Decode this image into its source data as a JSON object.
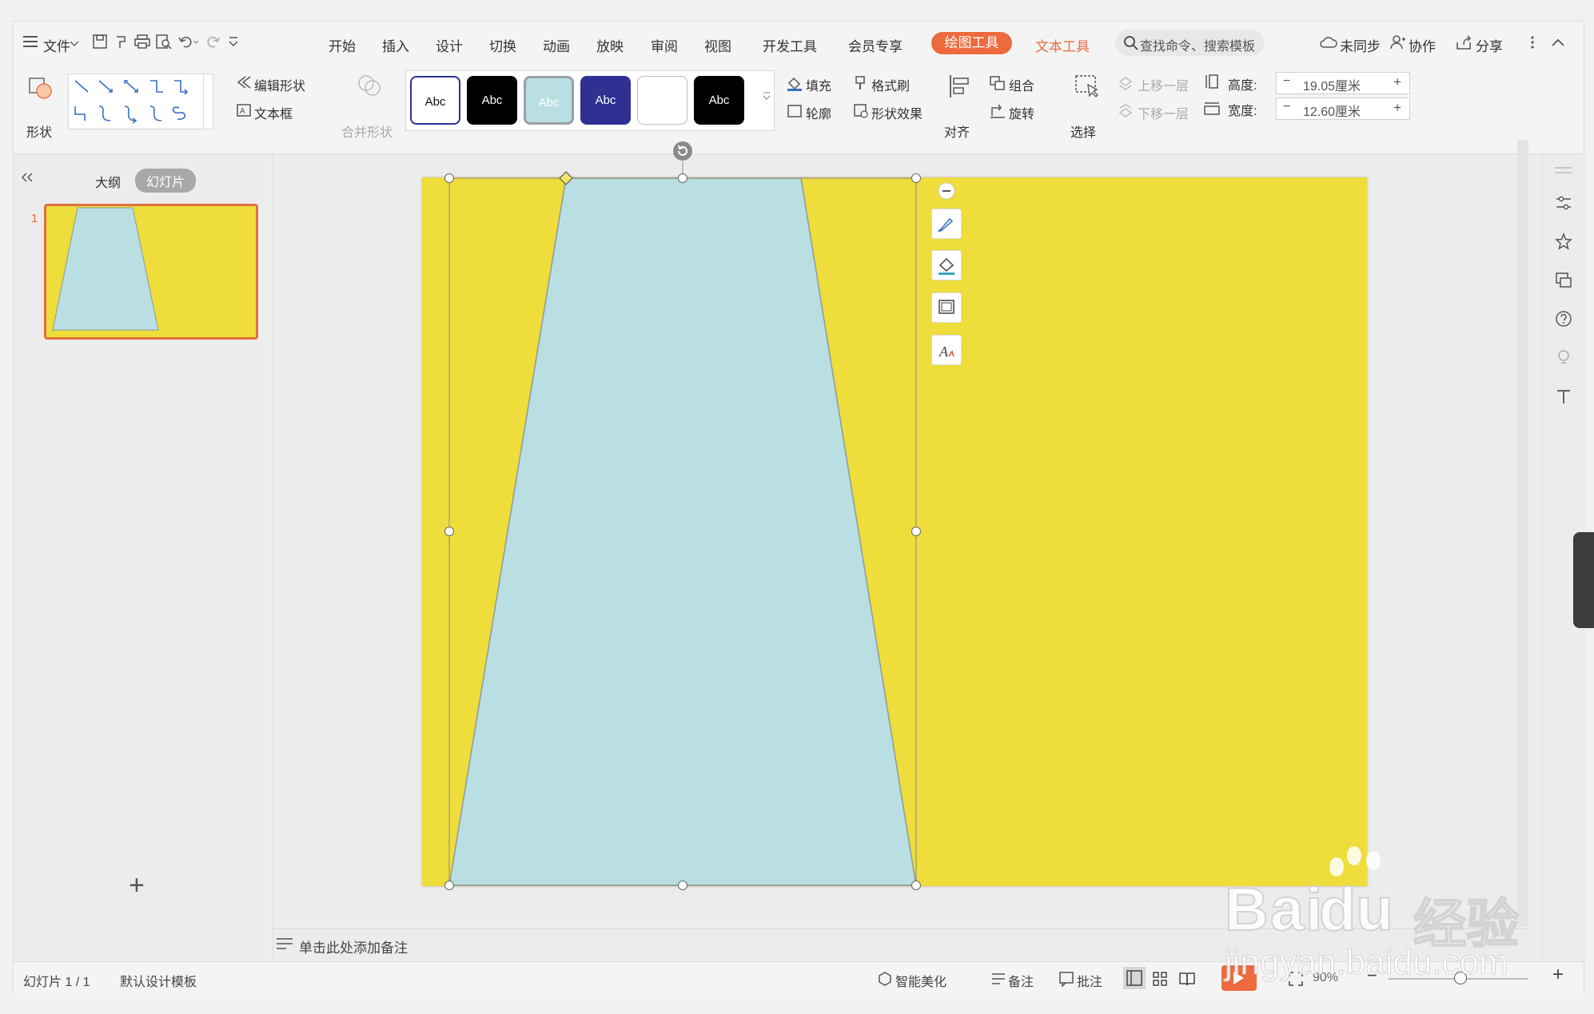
{
  "menubar": {
    "file_label": "文件",
    "tabs": [
      "开始",
      "插入",
      "设计",
      "切换",
      "动画",
      "放映",
      "审阅",
      "视图",
      "开发工具",
      "会员专享"
    ],
    "active_tab": "绘图工具",
    "text_tool_tab": "文本工具",
    "search_placeholder": "查找命令、搜索模板",
    "unsynced_label": "未同步",
    "collab_label": "协作",
    "share_label": "分享"
  },
  "ribbon": {
    "shape_label": "形状",
    "edit_shape_label": "编辑形状",
    "textbox_label": "文本框",
    "merge_shape_label": "合并形状",
    "style_label": "Abc",
    "fill_label": "填充",
    "format_painter_label": "格式刷",
    "outline_label": "轮廓",
    "shape_effect_label": "形状效果",
    "align_label": "对齐",
    "group_label": "组合",
    "rotate_label": "旋转",
    "select_label": "选择",
    "bring_forward_label": "上移一层",
    "send_backward_label": "下移一层",
    "height_label": "高度:",
    "height_value": "19.05厘米",
    "width_label": "宽度:",
    "width_value": "12.60厘米",
    "minus": "−",
    "plus": "+"
  },
  "left_panel": {
    "outline_tab": "大纲",
    "slides_tab": "幻灯片",
    "slide_number": "1",
    "add_icon": "+"
  },
  "notes_placeholder": "单击此处添加备注",
  "statusbar": {
    "slide_info": "幻灯片 1 / 1",
    "template": "默认设计模板",
    "smart_beautify": "智能美化",
    "notes": "备注",
    "comments": "批注",
    "zoom": "90%"
  },
  "watermark": {
    "brand": "Bai",
    "brand2": "du",
    "brand_cn": "经验",
    "url": "jingyan.baidu.com"
  },
  "colors": {
    "accent": "#ec6a3d",
    "slide_bg": "#eedd3b",
    "shape_fill": "#b9dfe2",
    "style_navy": "#2e3192"
  }
}
